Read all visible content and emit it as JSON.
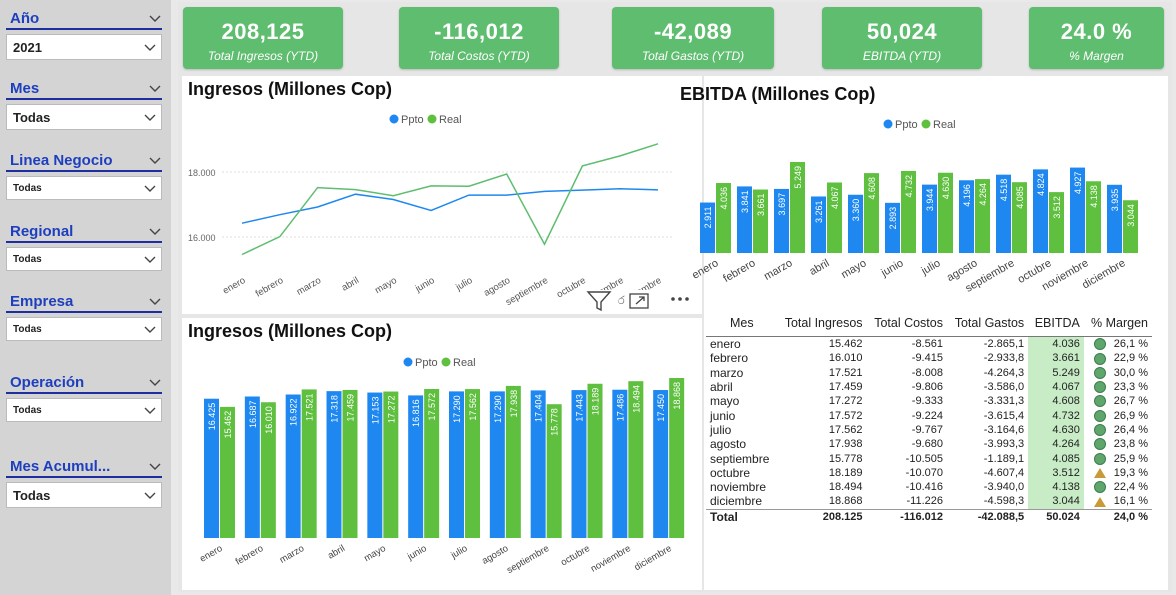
{
  "colors": {
    "ppto": "#1e88f0",
    "real": "#5fbf3f",
    "kpi_bg": "#5fbd70"
  },
  "slicers": [
    {
      "title": "Año",
      "value": "2021"
    },
    {
      "title": "Mes",
      "value": "Todas"
    },
    {
      "title": "Linea Negocio",
      "value": "Todas"
    },
    {
      "title": "Regional",
      "value": "Todas"
    },
    {
      "title": "Empresa",
      "value": "Todas"
    },
    {
      "title": "Operación",
      "value": "Todas"
    },
    {
      "title": "Mes Acumul...",
      "value": "Todas"
    }
  ],
  "kpis": [
    {
      "value": "208,125",
      "label": "Total Ingresos (YTD)"
    },
    {
      "value": "-116,012",
      "label": "Total Costos (YTD)"
    },
    {
      "value": "-42,089",
      "label": "Total Gastos (YTD)"
    },
    {
      "value": "50,024",
      "label": "EBITDA (YTD)"
    },
    {
      "value": "24.0 %",
      "label": "% Margen"
    }
  ],
  "chart_data": [
    {
      "type": "line",
      "title": "Ingresos (Millones Cop)",
      "categories": [
        "enero",
        "febrero",
        "marzo",
        "abril",
        "mayo",
        "junio",
        "julio",
        "agosto",
        "septiembre",
        "octubre",
        "noviembre",
        "diciembre"
      ],
      "series": [
        {
          "name": "Ppto",
          "values": [
            16425,
            16687,
            16922,
            17318,
            17153,
            16816,
            17290,
            17290,
            17404,
            17443,
            17486,
            17450
          ]
        },
        {
          "name": "Real",
          "values": [
            15462,
            16010,
            17521,
            17459,
            17272,
            17572,
            17562,
            17938,
            15778,
            18189,
            18494,
            18868
          ]
        }
      ],
      "yticks": [
        "16.000",
        "18.000"
      ],
      "ylim": [
        15000,
        19500
      ],
      "legend": "top"
    },
    {
      "type": "bar",
      "title": "EBITDA (Millones Cop)",
      "categories": [
        "enero",
        "febrero",
        "marzo",
        "abril",
        "mayo",
        "junio",
        "julio",
        "agosto",
        "septiembre",
        "octubre",
        "noviembre",
        "diciembre"
      ],
      "series": [
        {
          "name": "Ppto",
          "values": [
            2911,
            3841,
            3697,
            3261,
            3360,
            2893,
            3944,
            4196,
            4518,
            4824,
            4927,
            3935
          ]
        },
        {
          "name": "Real",
          "values": [
            4036,
            3661,
            5249,
            4067,
            4608,
            4732,
            4630,
            4264,
            4085,
            3512,
            4138,
            3044
          ]
        }
      ],
      "labels": {
        "Ppto": [
          "2.911",
          "3.841",
          "3.697",
          "3.261",
          "3.360",
          "2.893",
          "3.944",
          "4.196",
          "4.518",
          "4.824",
          "4.927",
          "3.935"
        ],
        "Real": [
          "4.036",
          "3.661",
          "5.249",
          "4.067",
          "4.608",
          "4.732",
          "4.630",
          "4.264",
          "4.085",
          "3.512",
          "4.138",
          "3.044"
        ]
      },
      "legend": "top"
    },
    {
      "type": "bar",
      "title": "Ingresos (Millones Cop)",
      "categories": [
        "enero",
        "febrero",
        "marzo",
        "abril",
        "mayo",
        "junio",
        "julio",
        "agosto",
        "septiembre",
        "octubre",
        "noviembre",
        "diciembre"
      ],
      "series": [
        {
          "name": "Ppto",
          "values": [
            16425,
            16687,
            16922,
            17318,
            17153,
            16816,
            17290,
            17290,
            17404,
            17443,
            17486,
            17450
          ]
        },
        {
          "name": "Real",
          "values": [
            15462,
            16010,
            17521,
            17459,
            17272,
            17572,
            17562,
            17938,
            15778,
            18189,
            18494,
            18868
          ]
        }
      ],
      "labels": {
        "Ppto": [
          "16.425",
          "16.687",
          "16.922",
          "17.318",
          "17.153",
          "16.816",
          "17.290",
          "17.290",
          "17.404",
          "17.443",
          "17.486",
          "17.450"
        ],
        "Real": [
          "15.462",
          "16.010",
          "17.521",
          "17.459",
          "17.272",
          "17.572",
          "17.562",
          "17.938",
          "15.778",
          "18.189",
          "18.494",
          "18.868"
        ]
      },
      "legend": "top"
    }
  ],
  "table": {
    "headers": [
      "Mes",
      "Total Ingresos",
      "Total Costos",
      "Total Gastos",
      "EBITDA",
      "% Margen"
    ],
    "rows": [
      {
        "mes": "enero",
        "ing": "15.462",
        "cos": "-8.561",
        "gas": "-2.865,1",
        "ebitda": "4.036",
        "status": "green",
        "margen": "26,1 %"
      },
      {
        "mes": "febrero",
        "ing": "16.010",
        "cos": "-9.415",
        "gas": "-2.933,8",
        "ebitda": "3.661",
        "status": "green",
        "margen": "22,9 %"
      },
      {
        "mes": "marzo",
        "ing": "17.521",
        "cos": "-8.008",
        "gas": "-4.264,3",
        "ebitda": "5.249",
        "status": "green",
        "margen": "30,0 %"
      },
      {
        "mes": "abril",
        "ing": "17.459",
        "cos": "-9.806",
        "gas": "-3.586,0",
        "ebitda": "4.067",
        "status": "green",
        "margen": "23,3 %"
      },
      {
        "mes": "mayo",
        "ing": "17.272",
        "cos": "-9.333",
        "gas": "-3.331,3",
        "ebitda": "4.608",
        "status": "green",
        "margen": "26,7 %"
      },
      {
        "mes": "junio",
        "ing": "17.572",
        "cos": "-9.224",
        "gas": "-3.615,4",
        "ebitda": "4.732",
        "status": "green",
        "margen": "26,9 %"
      },
      {
        "mes": "julio",
        "ing": "17.562",
        "cos": "-9.767",
        "gas": "-3.164,6",
        "ebitda": "4.630",
        "status": "green",
        "margen": "26,4 %"
      },
      {
        "mes": "agosto",
        "ing": "17.938",
        "cos": "-9.680",
        "gas": "-3.993,3",
        "ebitda": "4.264",
        "status": "green",
        "margen": "23,8 %"
      },
      {
        "mes": "septiembre",
        "ing": "15.778",
        "cos": "-10.505",
        "gas": "-1.189,1",
        "ebitda": "4.085",
        "status": "green",
        "margen": "25,9 %"
      },
      {
        "mes": "octubre",
        "ing": "18.189",
        "cos": "-10.070",
        "gas": "-4.607,4",
        "ebitda": "3.512",
        "status": "warn",
        "margen": "19,3 %"
      },
      {
        "mes": "noviembre",
        "ing": "18.494",
        "cos": "-10.416",
        "gas": "-3.940,0",
        "ebitda": "4.138",
        "status": "green",
        "margen": "22,4 %"
      },
      {
        "mes": "diciembre",
        "ing": "18.868",
        "cos": "-11.226",
        "gas": "-4.598,3",
        "ebitda": "3.044",
        "status": "warn",
        "margen": "16,1 %"
      }
    ],
    "total": {
      "mes": "Total",
      "ing": "208.125",
      "cos": "-116.012",
      "gas": "-42.088,5",
      "ebitda": "50.024",
      "margen": "24,0 %"
    }
  }
}
